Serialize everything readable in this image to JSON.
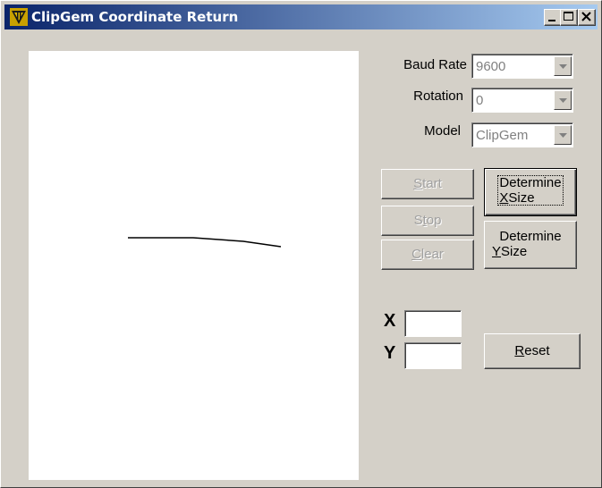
{
  "window": {
    "title": "ClipGem Coordinate Return",
    "controls": [
      "minimize-icon",
      "maximize-icon",
      "close-icon"
    ]
  },
  "settings": {
    "baud_rate": {
      "label": "Baud Rate",
      "value": "9600"
    },
    "rotation": {
      "label": "Rotation",
      "value": "0"
    },
    "model": {
      "label": "Model",
      "value": "ClipGem"
    }
  },
  "buttons": {
    "start": {
      "pre": "",
      "u": "S",
      "post": "tart",
      "enabled": false
    },
    "stop": {
      "pre": "S",
      "u": "t",
      "post": "op",
      "enabled": false
    },
    "clear": {
      "pre": "",
      "u": "C",
      "post": "lear",
      "enabled": false
    },
    "determine_x": {
      "line1": "Determine",
      "u": "X",
      "post": "Size"
    },
    "determine_y": {
      "line1": "Determine",
      "u": "Y",
      "post": "Size"
    },
    "reset": {
      "pre": "",
      "u": "R",
      "post": "eset"
    }
  },
  "coordinates": {
    "x_label": "X",
    "y_label": "Y",
    "x_value": "",
    "y_value": ""
  },
  "colors": {
    "titlebar_start": "#0a246a",
    "titlebar_end": "#a6caf0",
    "face": "#d4d0c8"
  }
}
